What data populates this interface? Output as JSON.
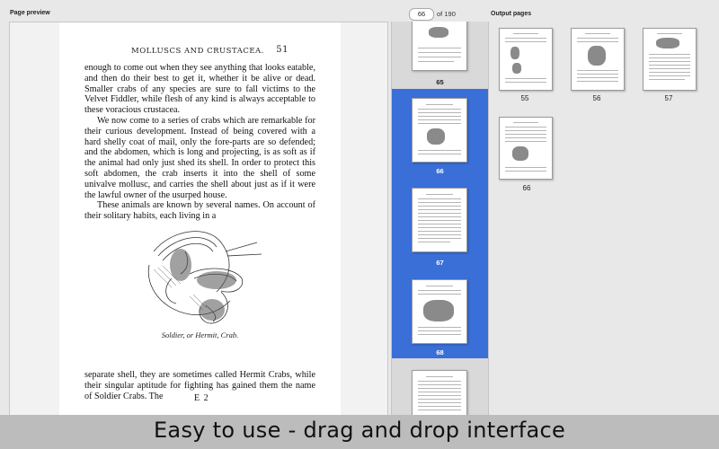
{
  "preview": {
    "label": "Page preview",
    "header_title": "MOLLUSCS AND CRUSTACEA.",
    "header_page": "51",
    "paragraphs_top": [
      "enough to come out when they see anything that looks eatable, and then do their best to get it, whether it be alive or dead. Smaller crabs of any species are sure to fall victims to the Velvet Fiddler, while flesh of any kind is always acceptable to these voracious crustacea.",
      "We now come to a series of crabs which are remarkable for their curious development. Instead of being covered with a hard shelly coat of mail, only the fore-parts are so defended; and the abdomen, which is long and projecting, is as soft as if the animal had only just shed its shell. In order to protect this soft abdomen, the crab inserts it into the shell of some univalve mollusc, and carries the shell about just as if it were the lawful owner of the usurped house.",
      "These animals are known by several names. On account of their solitary habits, each living in a"
    ],
    "illustration_icon": "hermit-crab-engraving",
    "caption": "Soldier, or Hermit, Crab.",
    "paragraph_bottom": "separate shell, they are sometimes called Hermit Crabs, while their singular aptitude for fighting has gained them the name of Soldier Crabs. The",
    "signature": "E 2"
  },
  "pager": {
    "current": "66",
    "of_label": "of",
    "total": "190"
  },
  "thumbnails": [
    {
      "number": "65",
      "selected": false
    },
    {
      "number": "66",
      "selected": true
    },
    {
      "number": "67",
      "selected": true
    },
    {
      "number": "68",
      "selected": true
    },
    {
      "number": "",
      "selected": false
    }
  ],
  "output": {
    "label": "Output pages",
    "pages": [
      {
        "number": "55"
      },
      {
        "number": "56"
      },
      {
        "number": "57"
      },
      {
        "number": "66"
      }
    ]
  },
  "banner": {
    "text": "Easy to use - drag and drop interface"
  },
  "colors": {
    "selection": "#3a6fd8",
    "panel_bg": "#e8e8e8",
    "banner_bg": "#bcbcbc"
  }
}
